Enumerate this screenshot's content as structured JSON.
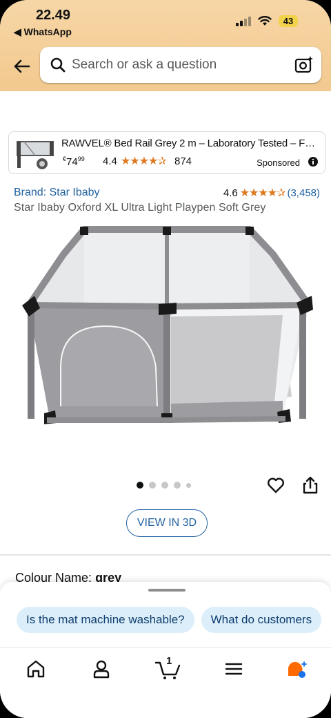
{
  "status_bar": {
    "time": "22.49",
    "back_app": "◀ WhatsApp",
    "battery": "43"
  },
  "search": {
    "placeholder": "Search or ask a question"
  },
  "sponsored_ad": {
    "title": "RAWVEL® Bed Rail Grey 2 m – Laboratory Tested – Fall...",
    "price_symbol": "€",
    "price_whole": "74",
    "price_fraction": "99",
    "rating": "4.4",
    "stars": "★★★★✰",
    "review_count": "874",
    "sponsored_label": "Sponsored"
  },
  "product": {
    "brand": "Brand: Star Ibaby",
    "rating": "4.6",
    "stars": "★★★★✰",
    "review_count": "(3,458)",
    "title": "Star Ibaby Oxford XL Ultra Light Playpen Soft Grey",
    "image_count": 5,
    "active_image": 1,
    "view_3d_label": "VIEW IN 3D",
    "colour_label": "Colour Name:",
    "colour_value": "grey"
  },
  "suggestions": {
    "chips": [
      "Is the mat machine washable?",
      "What do customers"
    ]
  },
  "bottom_nav": {
    "items": [
      "home-icon",
      "account-icon",
      "cart-icon",
      "menu-icon",
      "rufus-icon"
    ],
    "cart_count": "1"
  },
  "colors": {
    "header_bg": "#f2c98f",
    "link": "#2162a1",
    "star": "#de7921",
    "chip_bg": "#dbeefa",
    "rufus_orange": "#ff6a00",
    "rufus_blue": "#1a73e8"
  }
}
